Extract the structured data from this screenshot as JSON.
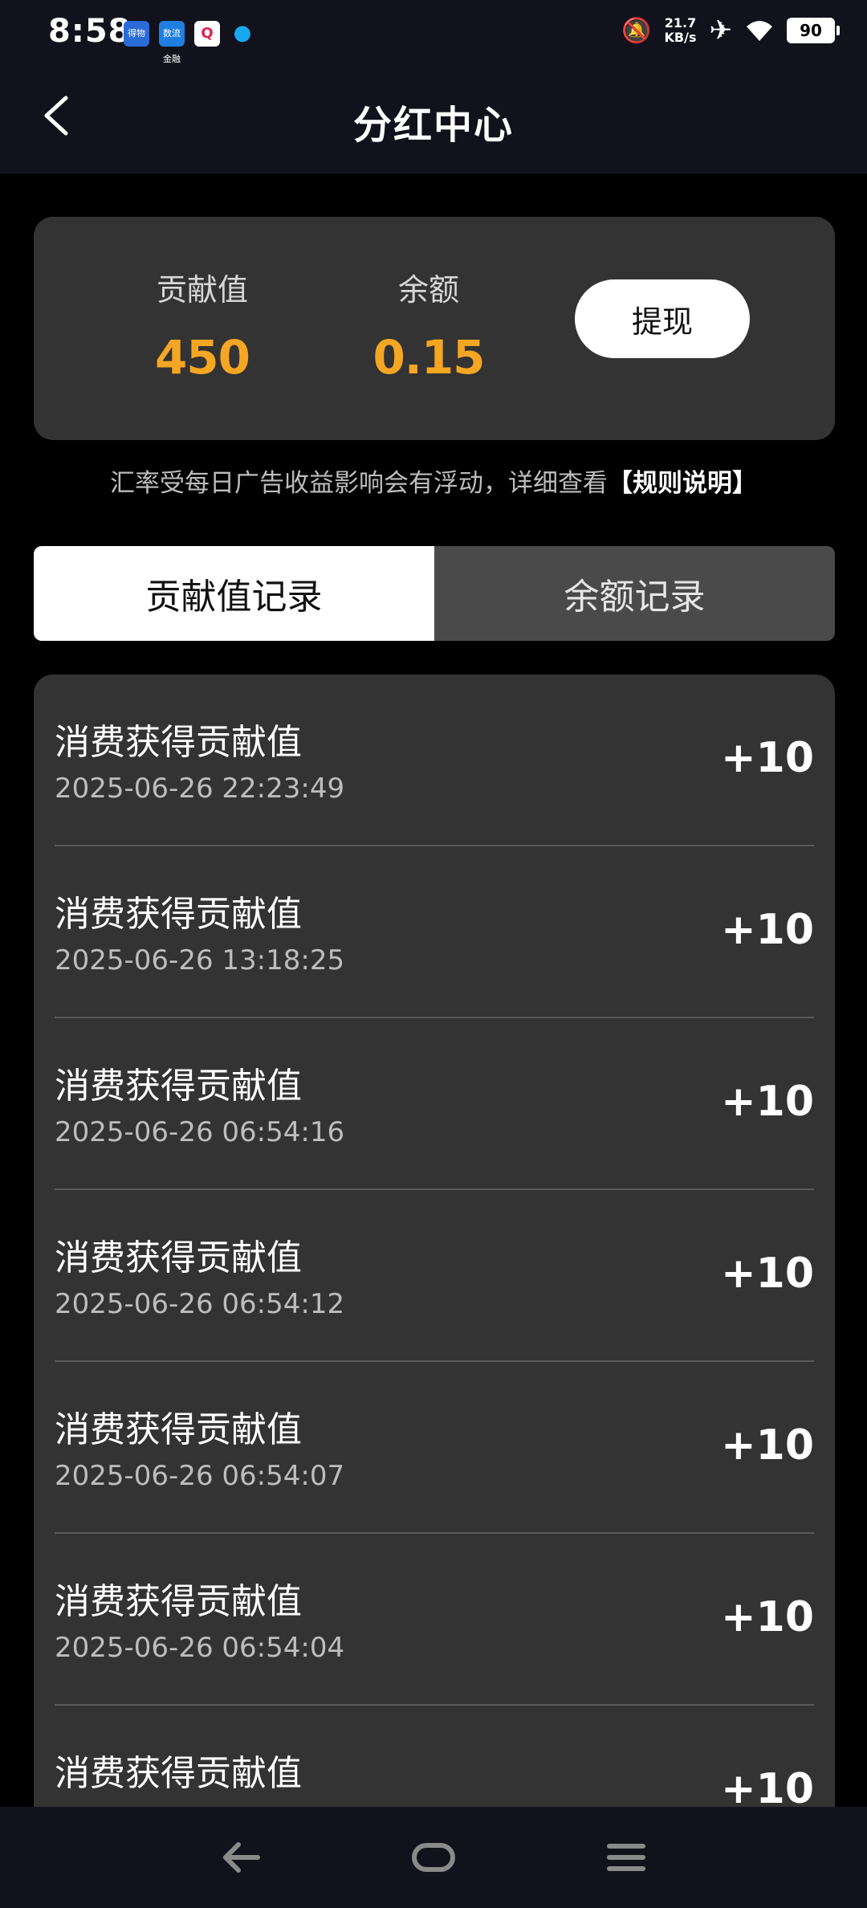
{
  "status_bar": {
    "time": "8:58",
    "notification_apps": [
      "app-1",
      "app-2",
      "app-3",
      "qq"
    ],
    "app_icon_text": {
      "app1": "得物",
      "app2": "数流金融",
      "app3": "Q"
    },
    "network_speed_value": "21.7",
    "network_speed_unit": "KB/s",
    "battery": "90"
  },
  "header": {
    "title": "分红中心"
  },
  "summary": {
    "contribution_label": "贡献值",
    "contribution_value": "450",
    "balance_label": "余额",
    "balance_value": "0.15",
    "withdraw_label": "提现",
    "accent_color": "#f5a623"
  },
  "notice": {
    "text": "汇率受每日广告收益影响会有浮动，详细查看",
    "link": "【规则说明】"
  },
  "tabs": [
    {
      "label": "贡献值记录",
      "active": true
    },
    {
      "label": "余额记录",
      "active": false
    }
  ],
  "records": [
    {
      "title": "消费获得贡献值",
      "time": "2025-06-26 22:23:49",
      "amount": "+10"
    },
    {
      "title": "消费获得贡献值",
      "time": "2025-06-26 13:18:25",
      "amount": "+10"
    },
    {
      "title": "消费获得贡献值",
      "time": "2025-06-26 06:54:16",
      "amount": "+10"
    },
    {
      "title": "消费获得贡献值",
      "time": "2025-06-26 06:54:12",
      "amount": "+10"
    },
    {
      "title": "消费获得贡献值",
      "time": "2025-06-26 06:54:07",
      "amount": "+10"
    },
    {
      "title": "消费获得贡献值",
      "time": "2025-06-26 06:54:04",
      "amount": "+10"
    },
    {
      "title": "消费获得贡献值",
      "time": "",
      "amount": "+10"
    }
  ]
}
